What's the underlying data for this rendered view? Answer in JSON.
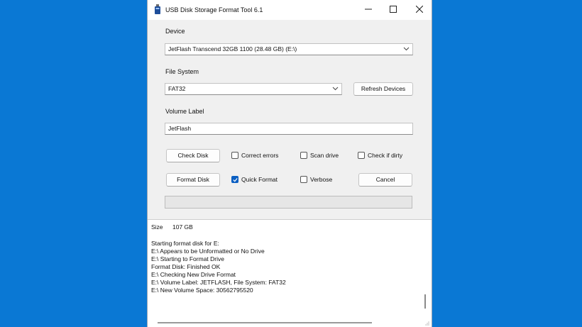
{
  "window": {
    "title": "USB Disk Storage Format Tool 6.1"
  },
  "device": {
    "label": "Device",
    "value": "JetFlash  Transcend 32GB  1100 (28.48 GB) (E:\\)"
  },
  "file_system": {
    "label": "File System",
    "value": "FAT32",
    "refresh_label": "Refresh Devices"
  },
  "volume": {
    "label": "Volume Label",
    "value": "JetFlash"
  },
  "actions": {
    "check_disk": "Check Disk",
    "format_disk": "Format Disk",
    "cancel": "Cancel"
  },
  "options": {
    "correct_errors": {
      "label": "Correct errors",
      "checked": false
    },
    "scan_drive": {
      "label": "Scan drive",
      "checked": false
    },
    "check_if_dirty": {
      "label": "Check if dirty",
      "checked": false
    },
    "quick_format": {
      "label": "Quick Format",
      "checked": true
    },
    "verbose": {
      "label": "Verbose",
      "checked": false
    }
  },
  "progress": {
    "fraction": 0
  },
  "log": {
    "size_label": "Size",
    "size_value": "107 GB",
    "lines": [
      "Starting format disk for E:",
      "E:\\ Appears to be Unformatted or No Drive",
      "E:\\ Starting to Format Drive",
      "Format Disk: Finished OK",
      "E:\\ Checking New Drive Format",
      "E:\\ Volume Label: JETFLASH, File System: FAT32",
      "E:\\ New Volume Space: 30562795520"
    ]
  },
  "colors": {
    "desktop": "#0a78d4",
    "accent": "#0b5fc2"
  },
  "icons": {
    "app": "usb-drive-icon",
    "minimize": "minimize-icon",
    "maximize": "maximize-icon",
    "close": "close-icon"
  }
}
